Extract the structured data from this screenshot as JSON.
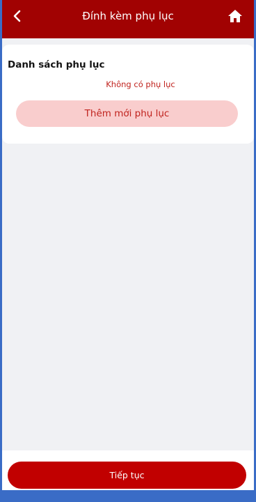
{
  "header": {
    "title": "Đính kèm phụ lục",
    "back_icon": "chevron-left-icon",
    "home_icon": "home-icon"
  },
  "attachments": {
    "title": "Danh sách phụ lục",
    "empty_text": "Không có phụ lục",
    "add_label": "Thêm mới phụ lục",
    "items": []
  },
  "footer": {
    "continue_label": "Tiếp tục"
  },
  "colors": {
    "header_bg": "#a10202",
    "accent": "#c10000",
    "accent_light": "#f9cdcd",
    "accent_text": "#c0231e",
    "page_bg": "#f0f1f4",
    "frame_bg": "#3a6cc6"
  }
}
